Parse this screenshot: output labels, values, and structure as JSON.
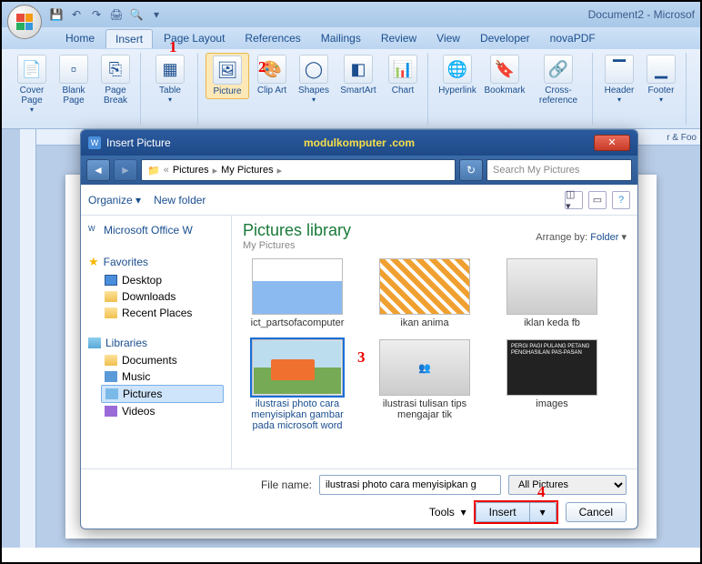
{
  "app": {
    "title": "Document2 - Microsof"
  },
  "qat_icons": [
    "save-icon",
    "undo-icon",
    "redo-icon",
    "print-icon",
    "preview-icon",
    "more-icon"
  ],
  "tabs": [
    "Home",
    "Insert",
    "Page Layout",
    "References",
    "Mailings",
    "Review",
    "View",
    "Developer",
    "novaPDF"
  ],
  "active_tab": 1,
  "ribbon": {
    "pages": [
      {
        "label": "Cover Page",
        "icon": "cover-page-icon"
      },
      {
        "label": "Blank Page",
        "icon": "blank-page-icon"
      },
      {
        "label": "Page Break",
        "icon": "page-break-icon"
      }
    ],
    "tables": [
      {
        "label": "Table",
        "icon": "table-icon"
      }
    ],
    "illustrations": [
      {
        "label": "Picture",
        "icon": "picture-icon",
        "selected": true
      },
      {
        "label": "Clip Art",
        "icon": "clipart-icon"
      },
      {
        "label": "Shapes",
        "icon": "shapes-icon"
      },
      {
        "label": "SmartArt",
        "icon": "smartart-icon"
      },
      {
        "label": "Chart",
        "icon": "chart-icon"
      }
    ],
    "links": [
      {
        "label": "Hyperlink",
        "icon": "hyperlink-icon"
      },
      {
        "label": "Bookmark",
        "icon": "bookmark-icon"
      },
      {
        "label": "Cross-reference",
        "icon": "crossref-icon"
      }
    ],
    "headerfooter": [
      {
        "label": "Header",
        "icon": "header-icon"
      },
      {
        "label": "Footer",
        "icon": "footer-icon"
      }
    ],
    "trailing_text": "r & Foo"
  },
  "dialog": {
    "title": "Insert Picture",
    "watermark": "modulkomputer .com",
    "breadcrumb": [
      "Pictures",
      "My Pictures"
    ],
    "search_placeholder": "Search My Pictures",
    "toolbar": {
      "organize": "Organize",
      "newfolder": "New folder"
    },
    "sidebar": {
      "top": "Microsoft Office W",
      "favorites": {
        "header": "Favorites",
        "items": [
          "Desktop",
          "Downloads",
          "Recent Places"
        ]
      },
      "libraries": {
        "header": "Libraries",
        "items": [
          "Documents",
          "Music",
          "Pictures",
          "Videos"
        ],
        "selected": 2
      }
    },
    "main": {
      "title": "Pictures library",
      "subtitle": "My Pictures",
      "arrange_label": "Arrange by:",
      "arrange_value": "Folder",
      "thumbs": [
        {
          "name": "ict_partsofacomputer"
        },
        {
          "name": "ikan anima"
        },
        {
          "name": "iklan keda fb"
        },
        {
          "name": "ilustrasi photo cara menyisipkan gambar pada microsoft word",
          "selected": true
        },
        {
          "name": "ilustrasi tulisan tips mengajar tik"
        },
        {
          "name": "images",
          "sign": "PERGI PAGI PULANG PETANG PENGHASILAN PAS-PASAN"
        }
      ]
    },
    "footer": {
      "filename_label": "File name:",
      "filename_value": "ilustrasi photo cara menyisipkan g",
      "filter": "All Pictures",
      "tools": "Tools",
      "insert": "Insert",
      "cancel": "Cancel"
    }
  },
  "annotations": {
    "a1": "1",
    "a2": "2",
    "a3": "3",
    "a4": "4"
  }
}
